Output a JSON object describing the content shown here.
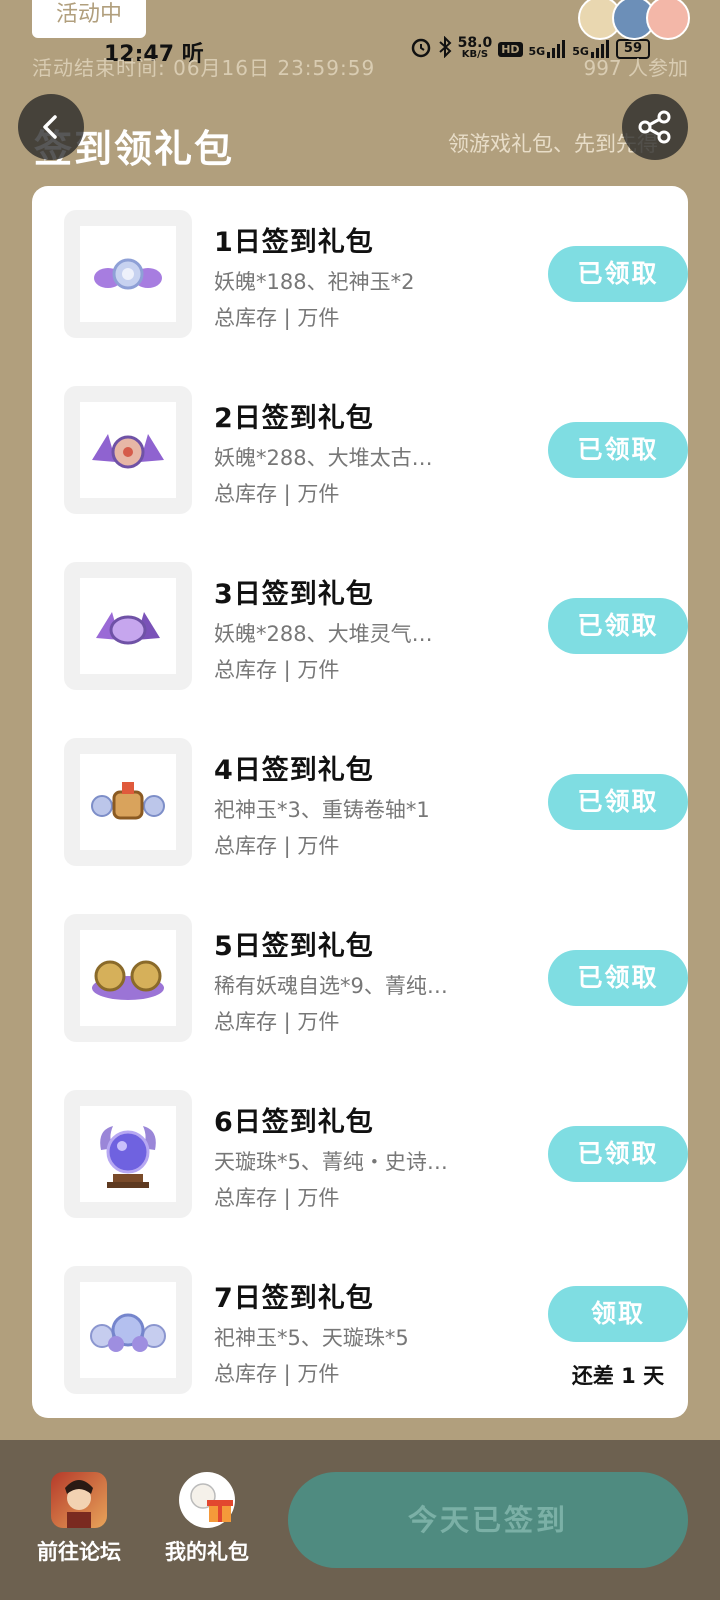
{
  "status_bar": {
    "time": "12:47",
    "time_suffix": "听",
    "net_speed": "58.0",
    "net_unit": "KB/S",
    "hd": "HD",
    "signal1": "5G",
    "signal2": "5G",
    "battery": "59"
  },
  "activity": {
    "tag": "活动中",
    "end_time": "活动结束时间: 06月16日 23:59:59",
    "participants": "997 人参加"
  },
  "header": {
    "title": "签到领礼包",
    "subtitle": "领游戏礼包、先到先得"
  },
  "gifts": [
    {
      "title": "1日签到礼包",
      "desc": "妖魄*188、祀神玉*2",
      "stock": "总库存 | 万件",
      "button": "已领取"
    },
    {
      "title": "2日签到礼包",
      "desc": "妖魄*288、大堆太古…",
      "stock": "总库存 | 万件",
      "button": "已领取"
    },
    {
      "title": "3日签到礼包",
      "desc": "妖魄*288、大堆灵气…",
      "stock": "总库存 | 万件",
      "button": "已领取"
    },
    {
      "title": "4日签到礼包",
      "desc": "祀神玉*3、重铸卷轴*1",
      "stock": "总库存 | 万件",
      "button": "已领取"
    },
    {
      "title": "5日签到礼包",
      "desc": "稀有妖魂自选*9、菁纯…",
      "stock": "总库存 | 万件",
      "button": "已领取"
    },
    {
      "title": "6日签到礼包",
      "desc": "天璇珠*5、菁纯・史诗…",
      "stock": "总库存 | 万件",
      "button": "已领取"
    },
    {
      "title": "7日签到礼包",
      "desc": "祀神玉*5、天璇珠*5",
      "stock": "总库存 | 万件",
      "button": "领取",
      "remaining": "还差 1 天"
    }
  ],
  "bottom": {
    "forum_label": "前往论坛",
    "gifts_label": "我的礼包",
    "checked_label": "今天已签到"
  },
  "colors": {
    "background": "#b19f7d",
    "button": "#7fdde2",
    "bottom_bar": "#6d6150",
    "checked_button": "#4f8b80"
  }
}
